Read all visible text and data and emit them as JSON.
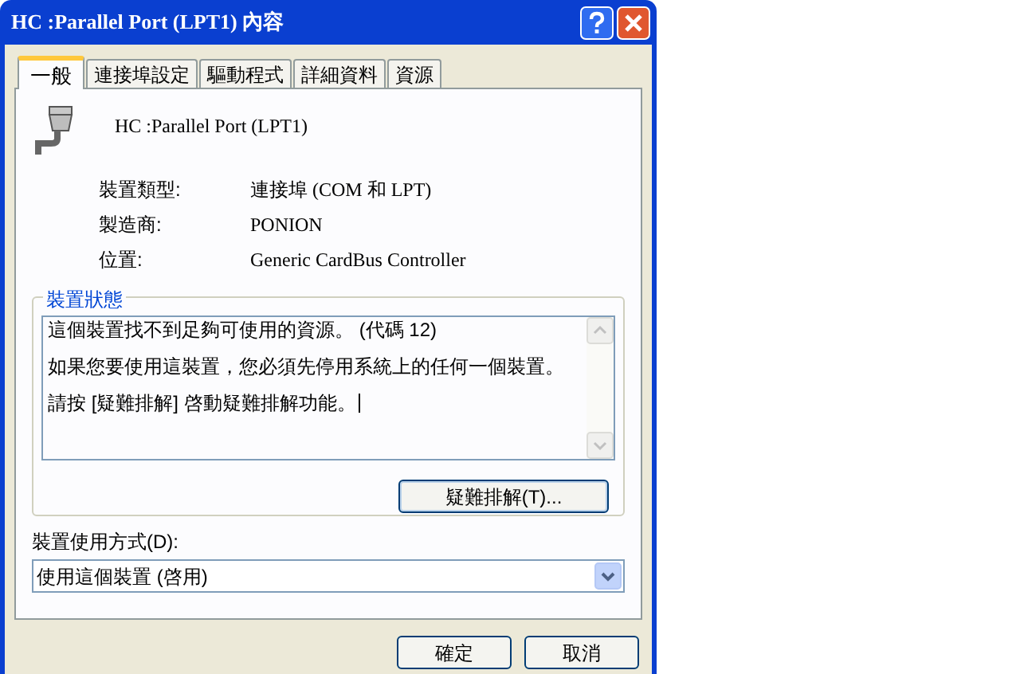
{
  "window": {
    "title": "HC :Parallel Port (LPT1) 內容"
  },
  "tabs": [
    {
      "label": "一般",
      "selected": true
    },
    {
      "label": "連接埠設定",
      "selected": false
    },
    {
      "label": "驅動程式",
      "selected": false
    },
    {
      "label": "詳細資料",
      "selected": false
    },
    {
      "label": "資源",
      "selected": false
    }
  ],
  "device_name": "HC :Parallel Port (LPT1)",
  "properties": [
    {
      "label": "裝置類型:",
      "value": "連接埠 (COM 和 LPT)"
    },
    {
      "label": "製造商:",
      "value": "PONION"
    },
    {
      "label": "位置:",
      "value": "Generic CardBus Controller"
    }
  ],
  "device_status": {
    "title": "裝置狀態",
    "lines": [
      "這個裝置找不到足夠可使用的資源。 (代碼 12)",
      "如果您要使用這裝置，您必須先停用系統上的任何一個裝置。",
      "請按 [疑難排解] 啓動疑難排解功能。"
    ],
    "button": "疑難排解(T)..."
  },
  "device_usage": {
    "label": "裝置使用方式(D):",
    "value": "使用這個裝置 (啓用)"
  },
  "buttons": [
    "確定",
    "取消"
  ]
}
